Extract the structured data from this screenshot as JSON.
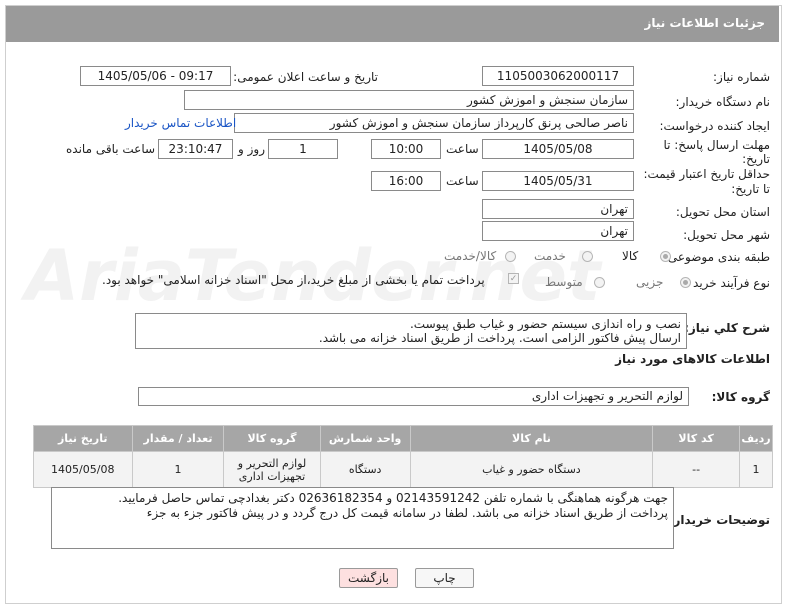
{
  "header": {
    "title": "جزئیات اطلاعات نیاز"
  },
  "fields": {
    "need_number_label": "شماره نیاز:",
    "need_number": "1105003062000117",
    "announce_label": "تاریخ و ساعت اعلان عمومی:",
    "announce_value": "1405/05/06 - 09:17",
    "buyer_org_label": "نام دستگاه خریدار:",
    "buyer_org": "سازمان سنجش و اموزش کشور",
    "creator_label": "ایجاد کننده درخواست:",
    "creator": "ناصر صالحی پرنق کارپرداز سازمان سنجش و اموزش کشور",
    "contact_link": "اطلاعات تماس خریدار",
    "deadline_label_1": "مهلت ارسال پاسخ: تا",
    "deadline_label_2": "تاریخ:",
    "deadline_date": "1405/05/08",
    "time_label": "ساعت",
    "deadline_time": "10:00",
    "days_value": "1",
    "days_label": "روز و",
    "remaining_time": "23:10:47",
    "remaining_label": "ساعت باقی مانده",
    "price_label_1": "حداقل تاریخ اعتبار قیمت:",
    "price_label_2": "تا تاریخ:",
    "price_date": "1405/05/31",
    "price_time": "16:00",
    "province_label": "استان محل تحویل:",
    "province": "تهران",
    "city_label": "شهر محل تحویل:",
    "city": "تهران",
    "category_label": "طبقه بندی موضوعی:",
    "category_options": [
      "کالا",
      "خدمت",
      "کالا/خدمت"
    ],
    "process_label": "نوع فرآیند خرید :",
    "process_options": [
      "جزیی",
      "متوسط"
    ],
    "payment_note": "پرداخت تمام یا بخشی از مبلغ خرید،از محل \"اسناد خزانه اسلامی\" خواهد بود.",
    "description_label": "شرح کلي نياز:",
    "description_line1": "نصب و راه اندازی سیستم حضور و غیاب طبق پیوست.",
    "description_line2": "ارسال پیش فاکتور الزامی است. پرداخت از طریق اسناد خزانه می باشد."
  },
  "goods": {
    "section_title": "اطلاعات کالاهای مورد نیاز",
    "group_label": "گروه کالا:",
    "group_value": "لوازم التحریر و تجهیزات اداری",
    "columns": [
      "ردیف",
      "کد کالا",
      "نام کالا",
      "واحد شمارش",
      "گروه کالا",
      "تعداد / مقدار",
      "تاریخ نیاز"
    ],
    "rows": [
      {
        "row": "1",
        "code": "--",
        "name": "دستگاه حضور و غیاب",
        "unit": "دستگاه",
        "group_line1": "لوازم التحریر و",
        "group_line2": "تجهیزات اداری",
        "qty": "1",
        "date": "1405/05/08"
      }
    ]
  },
  "buyer_notes": {
    "label": "توضیحات خریدار:",
    "line1": "جهت هرگونه هماهنگی با شماره تلفن 02143591242 و 02636182354 دکتر بغدادچی تماس حاصل فرمایید.",
    "line2": "پرداخت از طریق اسناد خزانه می باشد. لطفا در سامانه قیمت کل درج گردد و در پیش فاکتور جزء به جزء"
  },
  "buttons": {
    "print": "چاپ",
    "back": "بازگشت"
  },
  "watermark": "AriaTender.net",
  "colors": {
    "titlebar": "#9a9a9a",
    "link": "#1a55c5",
    "back_button": "#fde0e0"
  }
}
